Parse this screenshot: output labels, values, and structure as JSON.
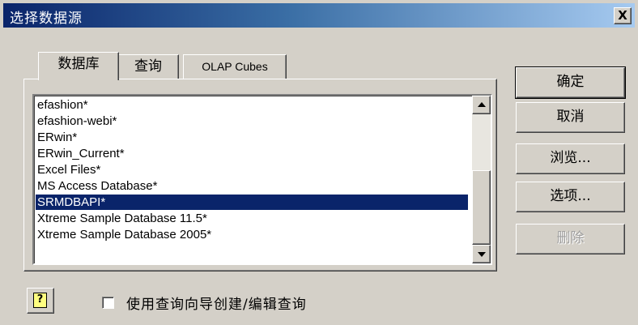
{
  "dialog": {
    "title": "选择数据源",
    "close_label": "X"
  },
  "tabs": [
    {
      "label": "数据库",
      "active": true
    },
    {
      "label": "查询",
      "active": false
    },
    {
      "label": "OLAP Cubes",
      "active": false
    }
  ],
  "datasource_list": {
    "items": [
      "efashion*",
      "efashion-webi*",
      "ERwin*",
      "ERwin_Current*",
      "Excel Files*",
      "MS Access Database*",
      "SRMDBAPI*",
      "Xtreme Sample Database 11.5*",
      "Xtreme Sample Database 2005*"
    ],
    "selected": "SRMDBAPI*"
  },
  "buttons": {
    "ok": "确定",
    "cancel": "取消",
    "browse": "浏览...",
    "options": "选项...",
    "delete": "删除"
  },
  "footer": {
    "help_icon": "help-icon",
    "help_glyph": "?",
    "checkbox_label": "使用查询向导创建/编辑查询",
    "checkbox_checked": false
  },
  "colors": {
    "selection": "#0a246a",
    "title_gradient_start": "#0a246a",
    "face": "#d4d0c8"
  }
}
